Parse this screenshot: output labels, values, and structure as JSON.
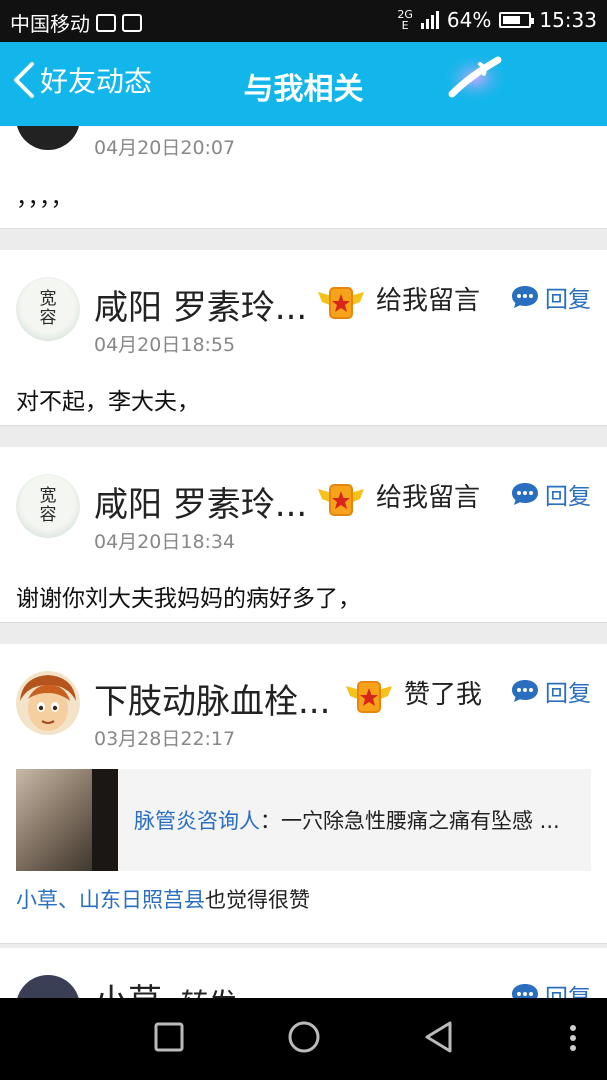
{
  "status_bar": {
    "carrier": "中国移动",
    "net_top": "2G",
    "net_bottom": "E",
    "battery": "64%",
    "time": "15:33"
  },
  "header": {
    "back_label": "好友动态",
    "title": "与我相关"
  },
  "feed": {
    "partial_top": {
      "time": "04月20日20:07",
      "content": "，，，，"
    },
    "posts": [
      {
        "name": "咸阳 罗素玲...",
        "avatar_text": [
          "宽",
          "容"
        ],
        "action": "给我留言",
        "reply": "回复",
        "time": "04月20日18:55",
        "content": "对不起，李大夫，"
      },
      {
        "name": "咸阳 罗素玲...",
        "avatar_text": [
          "宽",
          "容"
        ],
        "action": "给我留言",
        "reply": "回复",
        "time": "04月20日18:34",
        "content": "谢谢你刘大夫我妈妈的病好多了，"
      },
      {
        "name": "下肢动脉血栓...",
        "action": "赞了我",
        "reply": "回复",
        "time": "03月28日22:17",
        "quote_author": "脉管炎咨询人",
        "quote_text": "：一穴除急性腰痛之痛有坠感 ...",
        "likers": "小草、山东日照莒县",
        "likers_suffix": "也觉得很赞"
      }
    ],
    "partial_bottom": {
      "name": "小草",
      "action": "转发",
      "reply": "回复"
    }
  },
  "colors": {
    "header_bg": "#12b6ea",
    "link": "#2a6fbf"
  }
}
